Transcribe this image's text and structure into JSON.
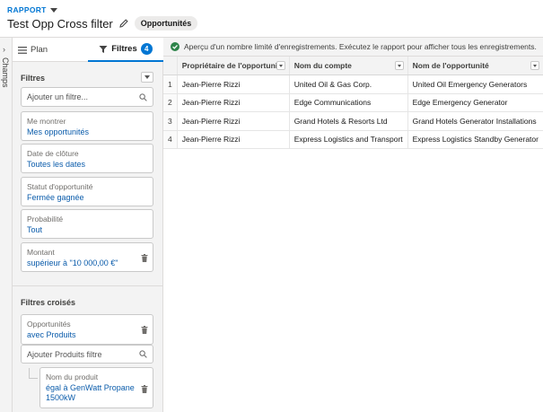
{
  "header": {
    "eyebrow": "RAPPORT",
    "title": "Test Opp Cross filter",
    "report_type": "Opportunités"
  },
  "rail": {
    "label": "Champs"
  },
  "tabs": {
    "plan_label": "Plan",
    "filters_label": "Filtres",
    "filters_count": "4"
  },
  "filters": {
    "section_title": "Filtres",
    "add_placeholder": "Ajouter un filtre...",
    "items": [
      {
        "label": "Me montrer",
        "value": "Mes opportunités"
      },
      {
        "label": "Date de clôture",
        "value": "Toutes les dates"
      },
      {
        "label": "Statut d'opportunité",
        "value": "Fermée gagnée"
      },
      {
        "label": "Probabilité",
        "value": "Tout"
      },
      {
        "label": "Montant",
        "value": "supérieur à \"10 000,00 €\""
      }
    ]
  },
  "cross_filters": {
    "section_title": "Filtres croisés",
    "object": {
      "label": "Opportunités",
      "value": "avec Produits"
    },
    "add_placeholder": "Ajouter Produits filtre",
    "sub_filter": {
      "label": "Nom du produit",
      "value": "égal à GenWatt Propane 1500kW"
    }
  },
  "notice": "Aperçu d'un nombre limité d'enregistrements. Exécutez le rapport pour afficher tous les enregistrements.",
  "table": {
    "columns": [
      "Propriétaire de l'opportunité",
      "Nom du compte",
      "Nom de l'opportunité"
    ],
    "rows": [
      {
        "num": "1",
        "owner": "Jean-Pierre Rizzi",
        "account": "United Oil & Gas Corp.",
        "opportunity": "United Oil Emergency Generators"
      },
      {
        "num": "2",
        "owner": "Jean-Pierre Rizzi",
        "account": "Edge Communications",
        "opportunity": "Edge Emergency Generator"
      },
      {
        "num": "3",
        "owner": "Jean-Pierre Rizzi",
        "account": "Grand Hotels & Resorts Ltd",
        "opportunity": "Grand Hotels Generator Installations"
      },
      {
        "num": "4",
        "owner": "Jean-Pierre Rizzi",
        "account": "Express Logistics and Transport",
        "opportunity": "Express Logistics Standby Generator"
      }
    ]
  },
  "colors": {
    "accent": "#0176d3",
    "link": "#0b5cab",
    "panel_bg": "#f3f3f3",
    "success": "#2e844a"
  }
}
